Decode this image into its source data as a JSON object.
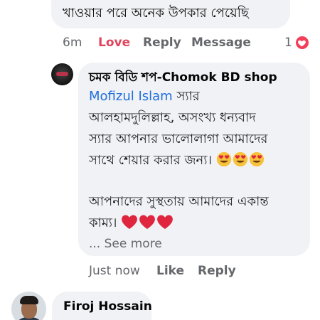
{
  "previous_comment": {
    "text": "খাওয়ার পরে অনেক উপকার পেয়েছি"
  },
  "previous_actions": {
    "time": "6m",
    "love_label": "Love",
    "reply_label": "Reply",
    "message_label": "Message",
    "reaction_count": "1",
    "reaction_type": "heart-icon",
    "reaction_color": "#f33e58"
  },
  "reply": {
    "author": "চমক বিডি শপ-Chomok BD shop",
    "mention": "Mofizul Islam",
    "text_line1_after_mention": " স্যার",
    "text_line2": "আলহামদুলিল্লাহ, অসংখ্য ধন্যবাদ",
    "text_line3": "স্যার  আপনার ভালোলাগা আমাদের",
    "text_line4": "সাথে শেয়ার করার জন্য। ",
    "text_para2_line1": "আপনাদের সুস্থতায় আমাদের একান্ত",
    "text_para2_line2": "কাম্য। ",
    "see_more": "... See more",
    "mention_color": "#216fdb"
  },
  "reply_actions": {
    "time": "Just now",
    "like_label": "Like",
    "reply_label": "Reply"
  },
  "next_comment": {
    "author": "Firoj Hossain"
  }
}
